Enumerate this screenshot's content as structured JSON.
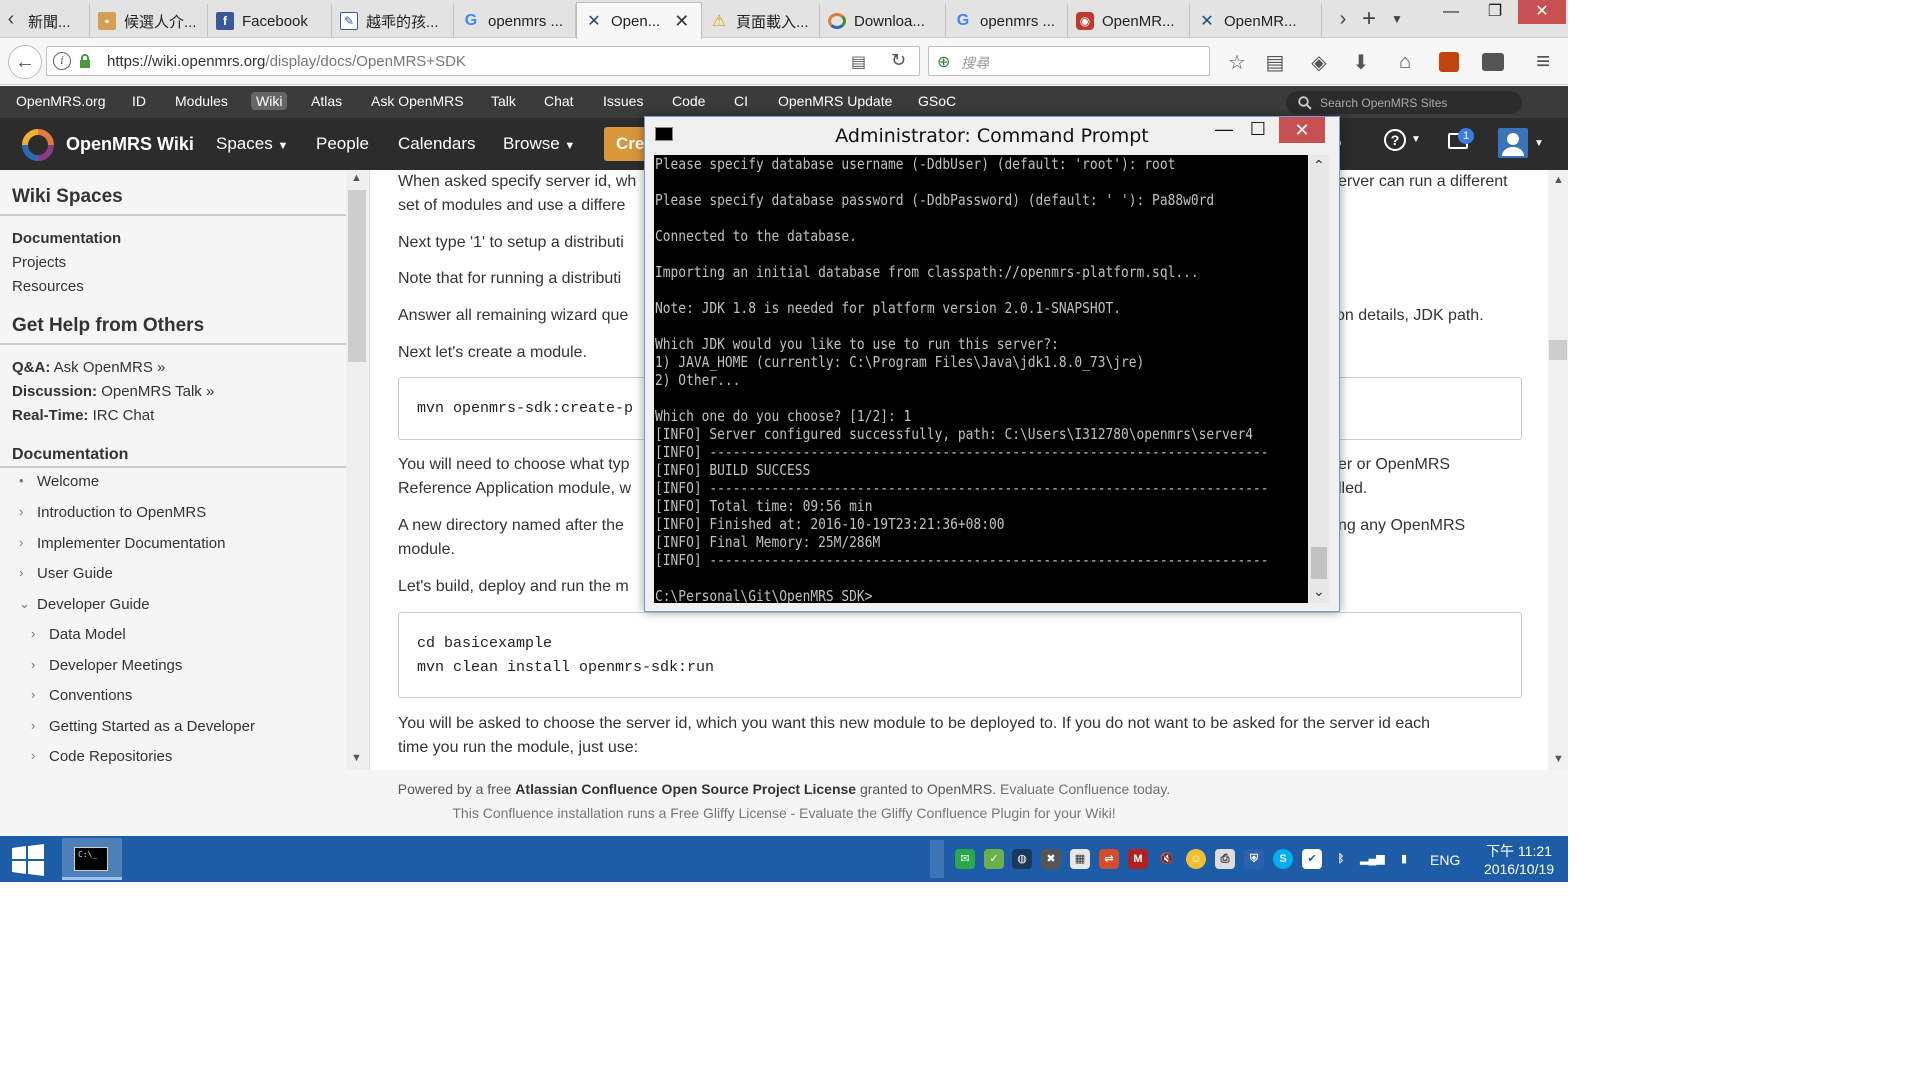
{
  "browser": {
    "tabs": [
      {
        "title": "新聞...",
        "icon": "news-icon"
      },
      {
        "title": "候選人介...",
        "icon": "page-icon"
      },
      {
        "title": "Facebook",
        "icon": "facebook-icon"
      },
      {
        "title": "越乖的孩...",
        "icon": "edit-icon"
      },
      {
        "title": "openmrs ...",
        "icon": "google-icon"
      },
      {
        "title": "Open...",
        "icon": "openmrs-icon",
        "active": true
      },
      {
        "title": "頁面載入...",
        "icon": "warning-icon"
      },
      {
        "title": "Downloa...",
        "icon": "openmrs-icon"
      },
      {
        "title": "openmrs ...",
        "icon": "google-icon"
      },
      {
        "title": "OpenMR...",
        "icon": "openmrs-icon"
      },
      {
        "title": "OpenMR...",
        "icon": "openmrs-icon"
      }
    ],
    "url_domain": "https://wiki.openmrs.org",
    "url_path": "/display/docs/OpenMRS+SDK",
    "search_placeholder": "搜尋"
  },
  "omrs_strip": {
    "links": [
      "OpenMRS.org",
      "ID",
      "Modules",
      "Wiki",
      "Atlas",
      "Ask OpenMRS",
      "Talk",
      "Chat",
      "Issues",
      "Code",
      "CI",
      "OpenMRS Update",
      "GSoC"
    ],
    "active": "Wiki",
    "search_placeholder": "Search OpenMRS Sites"
  },
  "conf_header": {
    "title": "OpenMRS Wiki",
    "nav": [
      "Spaces",
      "People",
      "Calendars",
      "Browse"
    ],
    "create_label": "Cre",
    "notification_count": "1"
  },
  "sidebar": {
    "heading_spaces": "Wiki Spaces",
    "spaces_links": [
      "Documentation",
      "Projects",
      "Resources"
    ],
    "heading_help": "Get Help from Others",
    "help_links": [
      {
        "label": "Q&A:",
        "value": "Ask OpenMRS »"
      },
      {
        "label": "Discussion:",
        "value": "OpenMRS Talk »"
      },
      {
        "label": "Real-Time:",
        "value": "IRC Chat"
      }
    ],
    "heading_docs": "Documentation",
    "tree": [
      {
        "label": "Welcome",
        "level": 1,
        "marker": "•"
      },
      {
        "label": "Introduction to OpenMRS",
        "level": 1,
        "marker": "›"
      },
      {
        "label": "Implementer Documentation",
        "level": 1,
        "marker": "›"
      },
      {
        "label": "User Guide",
        "level": 1,
        "marker": "›"
      },
      {
        "label": "Developer Guide",
        "level": 1,
        "marker": "⌄"
      },
      {
        "label": "Data Model",
        "level": 2,
        "marker": "›"
      },
      {
        "label": "Developer Meetings",
        "level": 2,
        "marker": "›"
      },
      {
        "label": "Conventions",
        "level": 2,
        "marker": "›"
      },
      {
        "label": "Getting Started as a Developer",
        "level": 2,
        "marker": "›"
      },
      {
        "label": "Code Repositories",
        "level": 2,
        "marker": "›"
      }
    ]
  },
  "main": {
    "p1a": "When asked specify server id, wh",
    "p1a_right": "erver can run a different",
    "p1b": "set of modules and use a differe",
    "p2": "Next type '1' to setup a distributi",
    "p3": "Note that for running a distributi",
    "p4": "Answer all remaining wizard que",
    "p4_right": "on details, JDK path.",
    "p5": "Next let's create a module.",
    "code1": "mvn openmrs-sdk:create-p",
    "p6a": "You will need to choose what typ",
    "p6a_right": "er or OpenMRS",
    "p6b": "Reference Application module, w",
    "p6b_right": "lled.",
    "p7a": "A new directory named after the",
    "p7a_right": "ng any OpenMRS",
    "p7b": "module.",
    "p8": "Let's build, deploy and run the m",
    "code2_l1": "cd basicexample",
    "code2_l2": "mvn clean install openmrs-sdk:run",
    "p9a": "You will be asked to choose the server id, which you want this new module to be deployed to. If you do not want to be asked for the server id each",
    "p9b": "time you run the module, just use:"
  },
  "footer": {
    "l1_pre": "Powered by a free ",
    "l1_bold": "Atlassian Confluence Open Source Project License",
    "l1_mid": " granted to OpenMRS. ",
    "l1_link": "Evaluate Confluence today.",
    "l2": "This Confluence installation runs a Free Gliffy License - Evaluate the Gliffy Confluence Plugin for your Wiki!"
  },
  "cmd": {
    "title": "Administrator: Command Prompt",
    "lines": [
      "Please specify database username (-DdbUser) (default: 'root'): root",
      "",
      "Please specify database password (-DdbPassword) (default: ' '): Pa88w0rd",
      "",
      "Connected to the database.",
      "",
      "Importing an initial database from classpath://openmrs-platform.sql...",
      "",
      "Note: JDK 1.8 is needed for platform version 2.0.1-SNAPSHOT.",
      "",
      "Which JDK would you like to use to run this server?:",
      "1) JAVA_HOME (currently: C:\\Program Files\\Java\\jdk1.8.0_73\\jre)",
      "2) Other...",
      "",
      "Which one do you choose? [1/2]: 1",
      "[INFO] Server configured successfully, path: C:\\Users\\I312780\\openmrs\\server4",
      "[INFO] ------------------------------------------------------------------------",
      "[INFO] BUILD SUCCESS",
      "[INFO] ------------------------------------------------------------------------",
      "[INFO] Total time: 09:56 min",
      "[INFO] Finished at: 2016-10-19T23:21:36+08:00",
      "[INFO] Final Memory: 25M/286M",
      "[INFO] ------------------------------------------------------------------------",
      "",
      "C:\\Personal\\Git\\OpenMRS_SDK>"
    ]
  },
  "taskbar": {
    "lang": "ENG",
    "time": "下午 11:21",
    "date": "2016/10/19"
  },
  "colors": {
    "omrs_orange": "#d8963b",
    "taskbar_blue": "#1d5ca6",
    "close_red": "#c75050"
  }
}
